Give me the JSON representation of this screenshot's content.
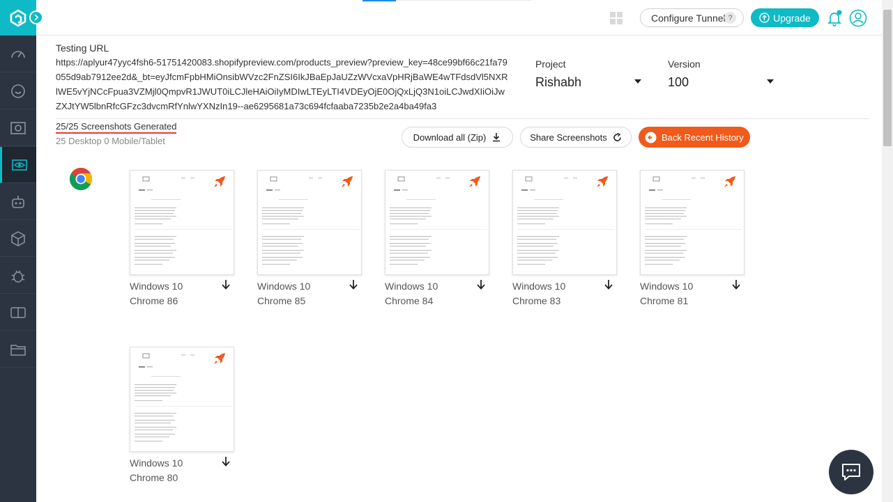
{
  "header": {
    "configure_tunnel_label": "Configure Tunnel",
    "help_badge": "?",
    "upgrade_label": "Upgrade"
  },
  "sidebar": {
    "items": [
      {
        "icon": "dashboard-icon"
      },
      {
        "icon": "realtime-icon"
      },
      {
        "icon": "automation-icon"
      },
      {
        "icon": "visual-ui-icon",
        "active": true
      },
      {
        "icon": "bot-icon"
      },
      {
        "icon": "box-icon"
      },
      {
        "icon": "bug-icon"
      },
      {
        "icon": "compare-icon"
      },
      {
        "icon": "folder-icon"
      }
    ]
  },
  "testing": {
    "url_label": "Testing URL",
    "url": "https://aplyur47yyc4fsh6-51751420083.shopifypreview.com/products_preview?preview_key=48ce99bf66c21fa79055d9ab7912ee2d&_bt=eyJfcmFpbHMiOnsibWVzc2FnZSI6IkJBaEpJaUZzWVcxaVpHRjBaWE4wTFdsdVl5NXRlWE5vYjNCcFpua3VZMjl0QmpvR1JWUT0iLCJleHAiOiIyMDIwLTEyLTI4VDEyOjE0OjQxLjQ3N1oiLCJwdXIiOiJwZXJtYW5lbnRfcGFzc3dvcmRfYnlwYXNzIn19--ae6295681a73c694fcfaaba7235b2e2a4ba49fa3"
  },
  "project": {
    "label": "Project",
    "value": "Rishabh"
  },
  "version": {
    "label": "Version",
    "value": "100"
  },
  "summary": {
    "generated": "25/25 Screenshots Generated",
    "breakdown": "25 Desktop 0 Mobile/Tablet"
  },
  "actions": {
    "download_all": "Download all (Zip)",
    "share": "Share Screenshots",
    "back_history": "Back Recent History"
  },
  "colors": {
    "accent": "#0ebac5",
    "orange": "#f05a1a",
    "sidebar": "#2b3440"
  },
  "screenshots": [
    {
      "os": "Windows 10",
      "browser": "Chrome 86"
    },
    {
      "os": "Windows 10",
      "browser": "Chrome 85"
    },
    {
      "os": "Windows 10",
      "browser": "Chrome 84"
    },
    {
      "os": "Windows 10",
      "browser": "Chrome 83"
    },
    {
      "os": "Windows 10",
      "browser": "Chrome 81"
    },
    {
      "os": "Windows 10",
      "browser": "Chrome 80"
    }
  ]
}
